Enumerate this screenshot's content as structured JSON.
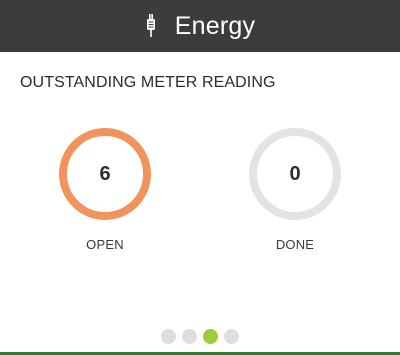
{
  "header": {
    "title": "Energy",
    "icon": "energy-plug-icon"
  },
  "section": {
    "title": "OUTSTANDING METER READING"
  },
  "stats": {
    "open": {
      "value": "6",
      "label": "OPEN",
      "ring_color": "#f0945c"
    },
    "done": {
      "value": "0",
      "label": "DONE",
      "ring_color": "#e3e3e3"
    }
  },
  "pager": {
    "total_pages": 4,
    "active_page": 3,
    "active_color": "#9ccb3b",
    "inactive_color": "#dedede"
  },
  "colors": {
    "header_bg": "#3c3c3c",
    "accent_bar": "#2e7d32"
  }
}
